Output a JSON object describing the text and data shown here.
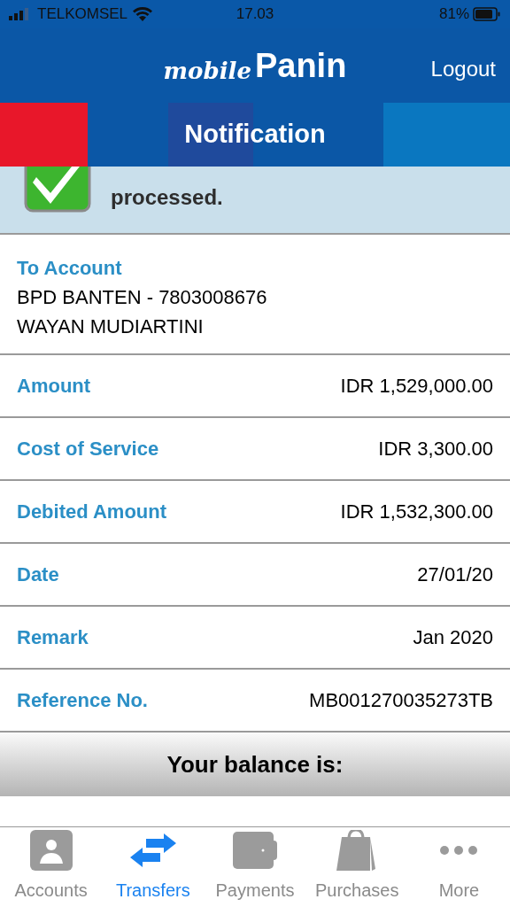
{
  "status_bar": {
    "carrier": "TELKOMSEL",
    "time": "17.03",
    "battery": "81%"
  },
  "header": {
    "logo_script": "mobile",
    "logo_bold": "Panin",
    "logout": "Logout"
  },
  "title": "Notification",
  "banner": {
    "message": "processed."
  },
  "to_account": {
    "label": "To Account",
    "lines": [
      "BPD BANTEN - 7803008676",
      "WAYAN MUDIARTINI"
    ]
  },
  "details": [
    {
      "label": "Amount",
      "value": "IDR 1,529,000.00"
    },
    {
      "label": "Cost of Service",
      "value": "IDR 3,300.00"
    },
    {
      "label": "Debited Amount",
      "value": "IDR 1,532,300.00"
    },
    {
      "label": "Date",
      "value": "27/01/20"
    },
    {
      "label": "Remark",
      "value": "Jan 2020"
    },
    {
      "label": "Reference No.",
      "value": "MB001270035273TB"
    }
  ],
  "balance": {
    "heading": "Your balance is:"
  },
  "tab_bar": [
    {
      "kind": "accounts",
      "label": "Accounts",
      "selected": false
    },
    {
      "kind": "transfers",
      "label": "Transfers",
      "selected": true
    },
    {
      "kind": "payments",
      "label": "Payments",
      "selected": false
    },
    {
      "kind": "purchases",
      "label": "Purchases",
      "selected": false
    },
    {
      "kind": "more",
      "label": "More",
      "selected": false
    }
  ]
}
